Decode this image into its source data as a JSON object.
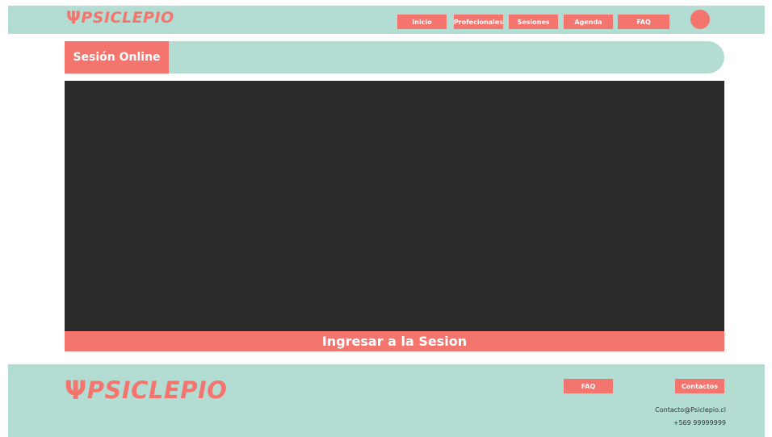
{
  "brand": {
    "name": "PSICLEPIO",
    "mark_glyph": "Ψ",
    "color": "#f4746e"
  },
  "header": {
    "nav": [
      {
        "label": "Inicio"
      },
      {
        "label": "Profecionales"
      },
      {
        "label": "Sesiones"
      },
      {
        "label": "Agenda"
      },
      {
        "label": "FAQ"
      }
    ]
  },
  "page": {
    "title": "Sesión Online",
    "join_label": "Ingresar a la Sesion"
  },
  "footer": {
    "faq_label": "FAQ",
    "contacts_label": "Contactos",
    "email": "Contacto@Psiclepio.cl",
    "phone": "+569 99999999"
  },
  "colors": {
    "accent": "#f4746e",
    "mint": "#b3ddd2",
    "video_bg": "#2b2b2b"
  }
}
